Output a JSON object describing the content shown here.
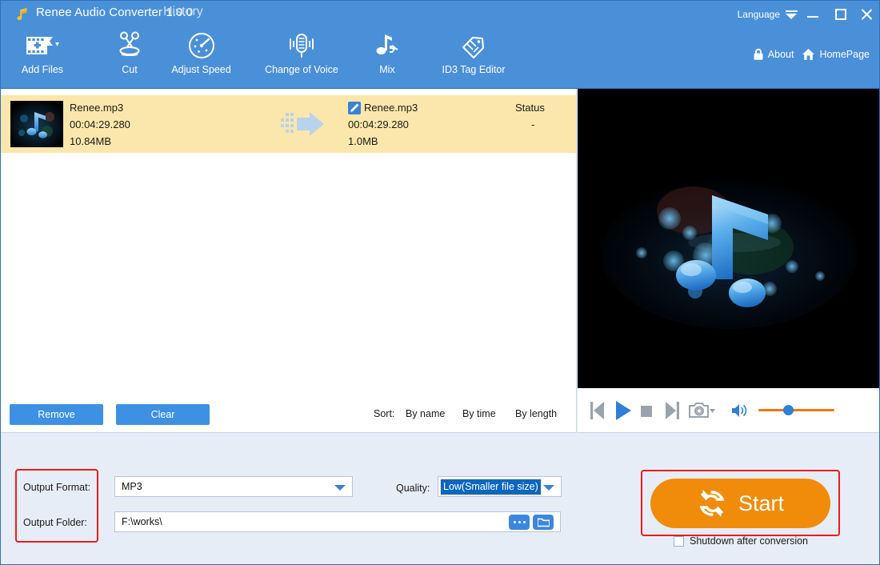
{
  "window": {
    "app_title": "Renee Audio Converter 1.0.0",
    "history_label": "History",
    "language_label": "Language",
    "minimize_icon": "minimize-icon",
    "maximize_icon": "maximize-icon",
    "close_icon": "close-icon",
    "logo_icon": "music-note-logo-icon"
  },
  "toolbar": {
    "items": [
      {
        "label": "Add Files",
        "icon": "add-files-icon",
        "has_caret": true
      },
      {
        "label": "Cut",
        "icon": "scissors-icon",
        "has_caret": false
      },
      {
        "label": "Adjust Speed",
        "icon": "speedometer-icon",
        "has_caret": false
      },
      {
        "label": "Change of Voice",
        "icon": "microphone-icon",
        "has_caret": false
      },
      {
        "label": "Mix",
        "icon": "mix-note-icon",
        "has_caret": false
      },
      {
        "label": "ID3 Tag Editor",
        "icon": "tag-pencil-icon",
        "has_caret": false
      }
    ],
    "about_label": "About",
    "about_icon": "lock-icon",
    "homepage_label": "HomePage",
    "homepage_icon": "home-icon"
  },
  "file_list": {
    "rows": [
      {
        "thumbnail_icon": "music-note-thumbnail",
        "source_name": "Renee.mp3",
        "source_duration": "00:04:29.280",
        "source_size": "10.84MB",
        "convert_arrow_icon": "convert-arrow-icon",
        "output_edit_icon": "edit-pencil-icon",
        "output_name": "Renee.mp3",
        "output_duration": "00:04:29.280",
        "output_size": "1.0MB",
        "status_header": "Status",
        "status_value": "-"
      }
    ]
  },
  "list_actions": {
    "remove_label": "Remove",
    "clear_label": "Clear",
    "sort_label": "Sort:",
    "sort_options": [
      "By name",
      "By time",
      "By length"
    ]
  },
  "player": {
    "prev_icon": "skip-previous-icon",
    "play_icon": "play-icon",
    "stop_icon": "stop-icon",
    "next_icon": "skip-next-icon",
    "snapshot_icon": "camera-icon",
    "volume_icon": "volume-icon",
    "volume_percent": 33
  },
  "settings": {
    "output_format_label": "Output Format:",
    "output_format_value": "MP3",
    "quality_label": "Quality:",
    "quality_value": "Low(Smaller file size)",
    "output_folder_label": "Output Folder:",
    "output_folder_value": "F:\\works\\",
    "browse_dots_icon": "ellipsis-icon",
    "open_folder_icon": "folder-icon",
    "start_label": "Start",
    "start_icon": "refresh-circular-icon",
    "shutdown_label": "Shutdown after conversion",
    "shutdown_checked": false
  },
  "colors": {
    "header_blue": "#4a90d9",
    "accent_blue": "#3d86de",
    "row_highlight": "#fbe7ab",
    "start_orange": "#f08c0a",
    "highlight_red": "#ef1c18",
    "panel_bg": "#e7edf7",
    "select_blue": "#0b66c2"
  }
}
